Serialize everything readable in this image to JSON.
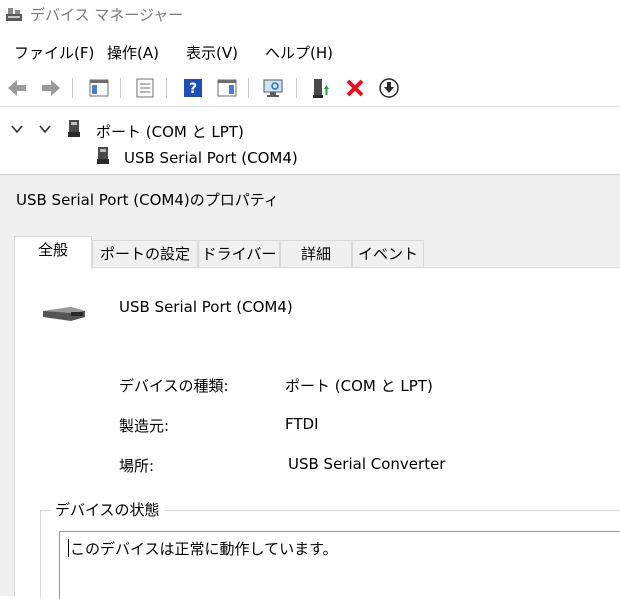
{
  "window": {
    "title": "デバイス マネージャー"
  },
  "menubar": {
    "items": [
      {
        "label": "ファイル(F)"
      },
      {
        "label": "操作(A)"
      },
      {
        "label": "表示(V)"
      },
      {
        "label": "ヘルプ(H)"
      }
    ]
  },
  "toolbar": {
    "buttons": [
      {
        "icon": "back-arrow-icon"
      },
      {
        "icon": "forward-arrow-icon"
      },
      {
        "icon": "show-hide-console-tree-icon"
      },
      {
        "icon": "properties-icon"
      },
      {
        "icon": "help-icon"
      },
      {
        "icon": "action-pane-icon"
      },
      {
        "icon": "scan-hardware-icon"
      },
      {
        "icon": "update-driver-icon"
      },
      {
        "icon": "uninstall-icon"
      },
      {
        "icon": "disable-device-icon"
      }
    ],
    "colors": {
      "help_blue": "#1f4fb4",
      "uninstall_red": "#e81123",
      "update_green": "#2ea043"
    }
  },
  "tree": {
    "category": {
      "label": "ポート (COM と LPT)"
    },
    "device": {
      "label": "USB Serial Port (COM4)"
    }
  },
  "dialog": {
    "title": "USB Serial Port (COM4)のプロパティ",
    "tabs": [
      {
        "label": "全般",
        "active": true
      },
      {
        "label": "ポートの設定",
        "active": false
      },
      {
        "label": "ドライバー",
        "active": false
      },
      {
        "label": "詳細",
        "active": false
      },
      {
        "label": "イベント",
        "active": false
      }
    ],
    "general": {
      "device_name": "USB Serial Port (COM4)",
      "properties": [
        {
          "label": "デバイスの種類:",
          "value": "ポート (COM と LPT)"
        },
        {
          "label": "製造元:",
          "value": "FTDI"
        },
        {
          "label": "場所:",
          "value": "USB Serial Converter"
        }
      ],
      "status_group": {
        "legend": "デバイスの状態",
        "text": "このデバイスは正常に動作しています。"
      }
    }
  }
}
